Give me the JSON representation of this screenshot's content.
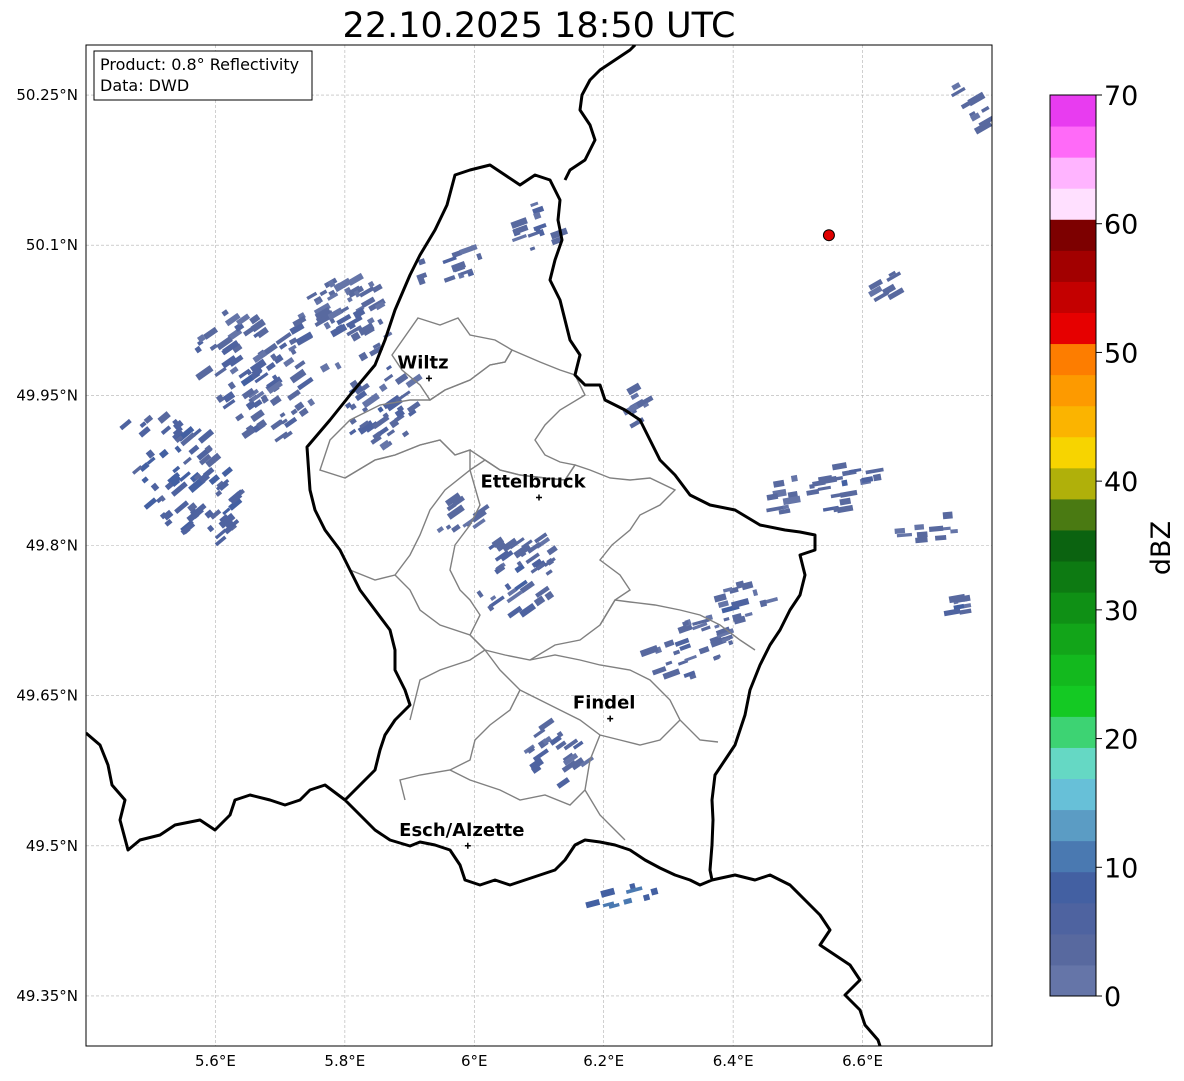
{
  "title": "22.10.2025 18:50 UTC",
  "info_box": {
    "product": "Product: 0.8° Reflectivity",
    "data": "Data: DWD"
  },
  "axes": {
    "lon_range": [
      5.4,
      6.8
    ],
    "lat_range": [
      49.3,
      50.3
    ],
    "lon_ticks": [
      {
        "value": 5.6,
        "label": "5.6°E"
      },
      {
        "value": 5.8,
        "label": "5.8°E"
      },
      {
        "value": 6.0,
        "label": "6°E"
      },
      {
        "value": 6.2,
        "label": "6.2°E"
      },
      {
        "value": 6.4,
        "label": "6.4°E"
      },
      {
        "value": 6.6,
        "label": "6.6°E"
      }
    ],
    "lat_ticks": [
      {
        "value": 49.35,
        "label": "49.35°N"
      },
      {
        "value": 49.5,
        "label": "49.5°N"
      },
      {
        "value": 49.65,
        "label": "49.65°N"
      },
      {
        "value": 49.8,
        "label": "49.8°N"
      },
      {
        "value": 49.95,
        "label": "49.95°N"
      },
      {
        "value": 50.1,
        "label": "50.1°N"
      },
      {
        "value": 50.25,
        "label": "50.25°N"
      }
    ],
    "grid": true
  },
  "cities": [
    {
      "name": "Wiltz",
      "lon": 5.93,
      "lat": 49.967
    },
    {
      "name": "Ettelbruck",
      "lon": 6.1,
      "lat": 49.848
    },
    {
      "name": "Findel",
      "lon": 6.21,
      "lat": 49.627
    },
    {
      "name": "Esch/Alzette",
      "lon": 5.99,
      "lat": 49.5
    }
  ],
  "radar_site": {
    "lon": 6.548,
    "lat": 50.11,
    "color": "#e00000"
  },
  "colorbar": {
    "label": "dBZ",
    "min": 0,
    "max": 70,
    "ticks": [
      0,
      10,
      20,
      30,
      40,
      50,
      60,
      70
    ],
    "colors": [
      "#6575a8",
      "#58699f",
      "#4e63a0",
      "#4360a2",
      "#4a79b1",
      "#5b9cc4",
      "#67c0d8",
      "#65d8c4",
      "#3dd373",
      "#14c923",
      "#13b91e",
      "#12a519",
      "#0f9015",
      "#0d7a12",
      "#0b6310",
      "#4a7a12",
      "#b0b00a",
      "#f7d400",
      "#fbb400",
      "#fd9a00",
      "#fd7d00",
      "#e60000",
      "#c40000",
      "#a20000",
      "#7d0000",
      "#ffe0ff",
      "#ffb4ff",
      "#ff6af8",
      "#e83cf0"
    ]
  },
  "precip_cells": [
    {
      "lon": 5.55,
      "lat": 49.87,
      "rlon": 0.07,
      "rlat": 0.08,
      "dbz": 6,
      "angle": -40
    },
    {
      "lon": 5.66,
      "lat": 49.97,
      "rlon": 0.08,
      "rlat": 0.07,
      "dbz": 4,
      "angle": -35
    },
    {
      "lon": 5.8,
      "lat": 50.02,
      "rlon": 0.09,
      "rlat": 0.045,
      "dbz": 3,
      "angle": -30
    },
    {
      "lon": 5.86,
      "lat": 49.94,
      "rlon": 0.07,
      "rlat": 0.04,
      "dbz": 4,
      "angle": -35
    },
    {
      "lon": 5.96,
      "lat": 50.08,
      "rlon": 0.05,
      "rlat": 0.02,
      "dbz": 3,
      "angle": -20
    },
    {
      "lon": 6.1,
      "lat": 50.12,
      "rlon": 0.04,
      "rlat": 0.025,
      "dbz": 3,
      "angle": -20
    },
    {
      "lon": 6.07,
      "lat": 49.77,
      "rlon": 0.07,
      "rlat": 0.04,
      "dbz": 4,
      "angle": -35
    },
    {
      "lon": 5.98,
      "lat": 49.83,
      "rlon": 0.04,
      "rlat": 0.02,
      "dbz": 3,
      "angle": -35
    },
    {
      "lon": 6.33,
      "lat": 49.7,
      "rlon": 0.07,
      "rlat": 0.03,
      "dbz": 3,
      "angle": -20
    },
    {
      "lon": 6.4,
      "lat": 49.74,
      "rlon": 0.06,
      "rlat": 0.02,
      "dbz": 3,
      "angle": -15
    },
    {
      "lon": 6.13,
      "lat": 49.59,
      "rlon": 0.04,
      "rlat": 0.035,
      "dbz": 4,
      "angle": -35
    },
    {
      "lon": 6.58,
      "lat": 49.86,
      "rlon": 0.06,
      "rlat": 0.025,
      "dbz": 4,
      "angle": -10
    },
    {
      "lon": 6.7,
      "lat": 49.82,
      "rlon": 0.05,
      "rlat": 0.015,
      "dbz": 3,
      "angle": -5
    },
    {
      "lon": 6.48,
      "lat": 49.85,
      "rlon": 0.03,
      "rlat": 0.02,
      "dbz": 3,
      "angle": -10
    },
    {
      "lon": 6.64,
      "lat": 50.06,
      "rlon": 0.03,
      "rlat": 0.015,
      "dbz": 3,
      "angle": -30
    },
    {
      "lon": 6.23,
      "lat": 49.45,
      "rlon": 0.06,
      "rlat": 0.01,
      "dbz": 9,
      "angle": -15
    },
    {
      "lon": 6.25,
      "lat": 49.94,
      "rlon": 0.02,
      "rlat": 0.02,
      "dbz": 3,
      "angle": -30
    },
    {
      "lon": 6.77,
      "lat": 50.24,
      "rlon": 0.02,
      "rlat": 0.03,
      "dbz": 3,
      "angle": -30
    },
    {
      "lon": 6.75,
      "lat": 49.74,
      "rlon": 0.02,
      "rlat": 0.008,
      "dbz": 4,
      "angle": -10
    }
  ]
}
